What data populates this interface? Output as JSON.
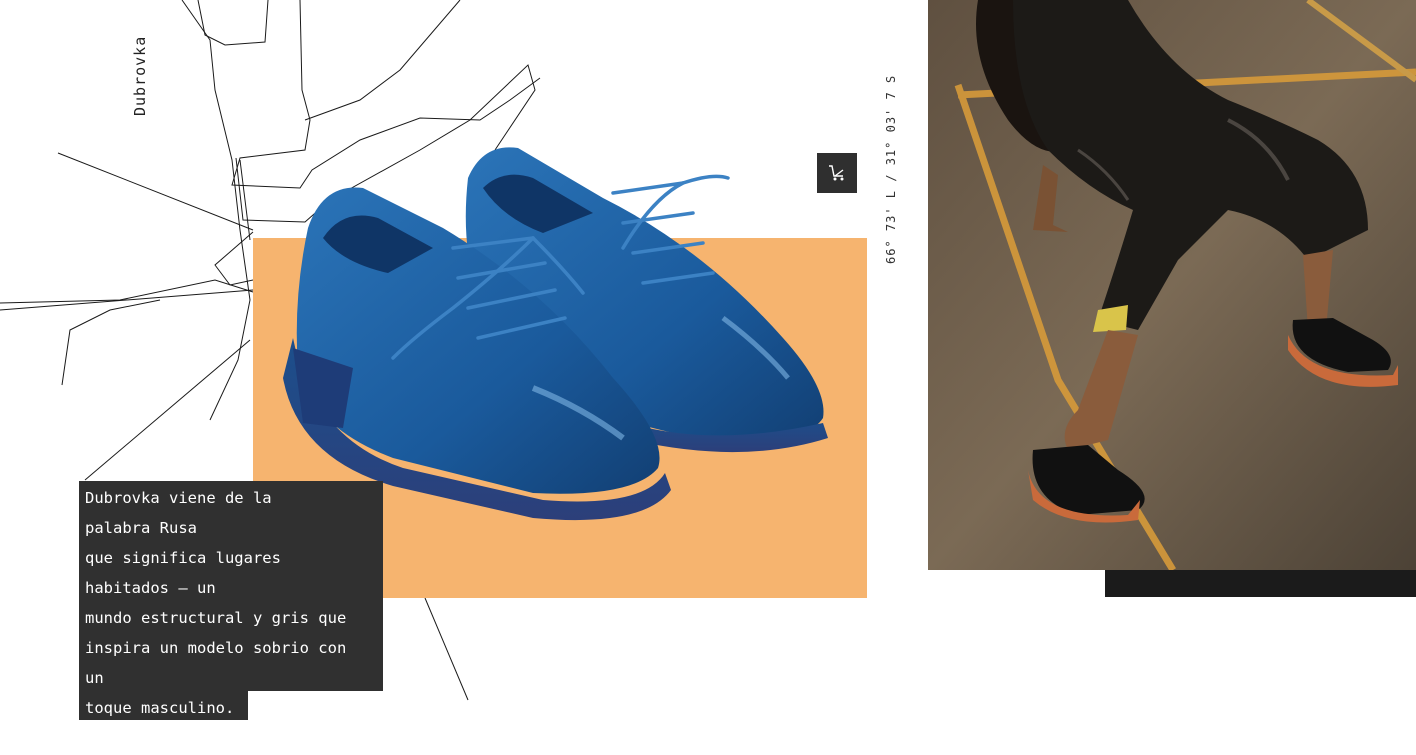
{
  "collection": {
    "name": "Dubrovka",
    "coordinates": "66° 73' L / 31° 03' 7 S"
  },
  "description": {
    "lines": [
      "Dubrovka viene de la",
      "palabra Rusa",
      "que significa lugares",
      "habitados — un",
      "mundo estructural y gris que",
      "inspira un modelo sobrio con",
      "un",
      "toque masculino."
    ]
  },
  "icons": {
    "cart": "shopping-cart-icon"
  },
  "colors": {
    "orange_panel": "#f6b46f",
    "shoe_blue": "#1d5a9a",
    "text_box": "#303030",
    "dark_strip": "#1b1b1b"
  }
}
